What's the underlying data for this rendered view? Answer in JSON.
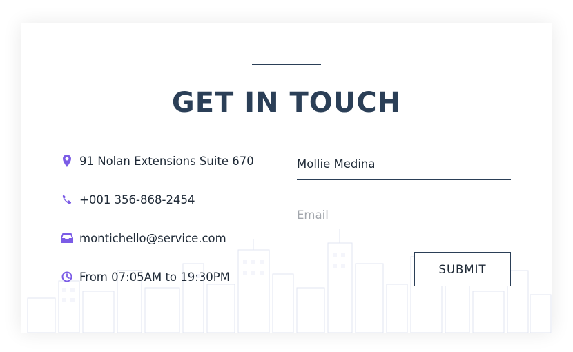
{
  "heading": "GET IN TOUCH",
  "contact": {
    "address": "91 Nolan Extensions Suite 670",
    "phone": "+001 356-868-2454",
    "email": "montichello@service.com",
    "hours": "From 07:05AM to 19:30PM"
  },
  "form": {
    "name_value": "Mollie Medina",
    "email_placeholder": "Email",
    "submit_label": "SUBMIT"
  },
  "icons": {
    "address": "map-pin-icon",
    "phone": "phone-icon",
    "email": "inbox-icon",
    "hours": "clock-icon"
  },
  "colors": {
    "heading": "#2b3f57",
    "icon_accent": "#7b5ce6",
    "active_underline": "#2b3f57",
    "inactive_underline": "#d6d9de",
    "placeholder": "#a3a7ad"
  }
}
